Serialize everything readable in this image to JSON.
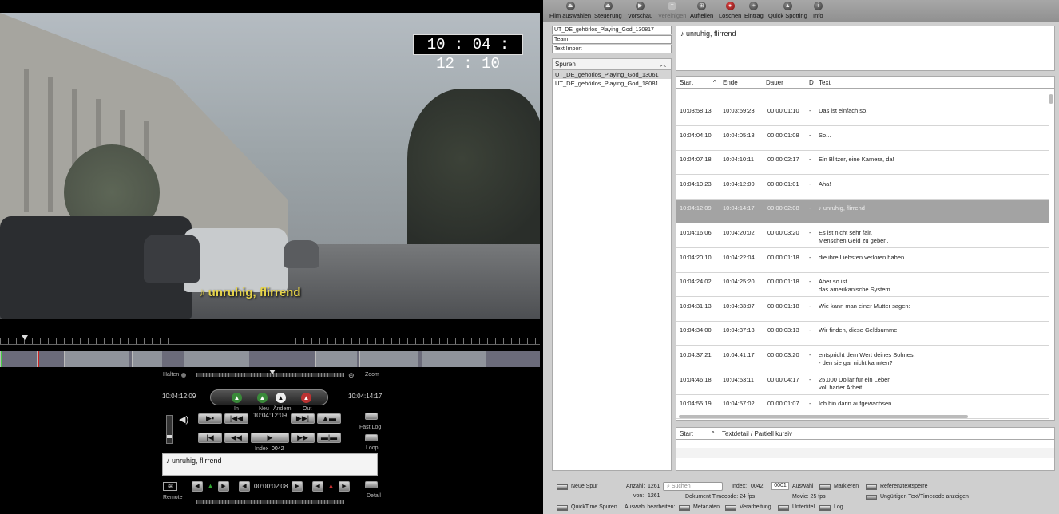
{
  "video": {
    "timecode": "10 : 04 : 12 : 10",
    "subtitle": "♪ unruhig, flirrend"
  },
  "controls": {
    "halten": "Halten",
    "zoom": "Zoom",
    "tc_left": "10:04:12:09",
    "tc_right": "10:04:14:17",
    "in": "In",
    "neu": "Neu",
    "aendern": "Ändern",
    "out": "Out",
    "tc_center": "10:04:12:09",
    "index_label": "Index",
    "index_value": "0042",
    "fast_log": "Fast Log",
    "loop": "Loop",
    "remote": "Remote",
    "detail": "Detail",
    "duration": "00:00:02:08",
    "subtitle_text": "♪ unruhig, flirrend"
  },
  "toolbar": {
    "items": [
      {
        "label": "Film auswählen",
        "icon": "film-icon"
      },
      {
        "label": "Steuerung",
        "icon": "eject-icon"
      },
      {
        "label": "Vorschau",
        "icon": "play-icon"
      },
      {
        "label": "Vereinigen",
        "icon": "merge-icon"
      },
      {
        "label": "Aufteilen",
        "icon": "split-icon"
      },
      {
        "label": "Löschen",
        "icon": "delete-icon"
      },
      {
        "label": "Eintrag",
        "icon": "plus-icon"
      },
      {
        "label": "Quick Spotting",
        "icon": "spotting-icon"
      },
      {
        "label": "Info",
        "icon": "info-icon"
      }
    ]
  },
  "files": [
    "UT_DE_gehörlos_Playing_God_130817",
    "Team",
    "Text Import"
  ],
  "tracks": {
    "header": "Spuren",
    "items": [
      "UT_DE_gehörlos_Playing_God_13061",
      "UT_DE_gehörlos_Playing_God_18081"
    ]
  },
  "preview": "♪ unruhig, flirrend",
  "table": {
    "headers": [
      "Start",
      "Ende",
      "Dauer",
      "D",
      "Text"
    ],
    "rows": [
      {
        "start": "10:03:58:13",
        "end": "10:03:59:23",
        "dur": "00:00:01:10",
        "d": "-",
        "text": "Das ist einfach so."
      },
      {
        "start": "10:04:04:10",
        "end": "10:04:05:18",
        "dur": "00:00:01:08",
        "d": "-",
        "text": "So..."
      },
      {
        "start": "10:04:07:18",
        "end": "10:04:10:11",
        "dur": "00:00:02:17",
        "d": "-",
        "text": "Ein Blitzer, eine Kamera, da!"
      },
      {
        "start": "10:04:10:23",
        "end": "10:04:12:00",
        "dur": "00:00:01:01",
        "d": "-",
        "text": "Aha!"
      },
      {
        "start": "10:04:12:09",
        "end": "10:04:14:17",
        "dur": "00:00:02:08",
        "d": "-",
        "text": "♪ unruhig, flirrend"
      },
      {
        "start": "10:04:16:06",
        "end": "10:04:20:02",
        "dur": "00:00:03:20",
        "d": "-",
        "text": "Es ist nicht sehr fair,",
        "text2": "Menschen Geld zu geben,"
      },
      {
        "start": "10:04:20:10",
        "end": "10:04:22:04",
        "dur": "00:00:01:18",
        "d": "-",
        "text": "die ihre Liebsten verloren haben."
      },
      {
        "start": "10:04:24:02",
        "end": "10:04:25:20",
        "dur": "00:00:01:18",
        "d": "-",
        "text": "Aber so ist",
        "text2": "das amerikanische System."
      },
      {
        "start": "10:04:31:13",
        "end": "10:04:33:07",
        "dur": "00:00:01:18",
        "d": "-",
        "text": "Wie kann man einer Mutter sagen:"
      },
      {
        "start": "10:04:34:00",
        "end": "10:04:37:13",
        "dur": "00:00:03:13",
        "d": "-",
        "text": "Wir finden, diese Geldsumme"
      },
      {
        "start": "10:04:37:21",
        "end": "10:04:41:17",
        "dur": "00:00:03:20",
        "d": "-",
        "text": "entspricht dem Wert deines Sohnes,",
        "text2": "- den sie gar nicht kannten?"
      },
      {
        "start": "10:04:46:18",
        "end": "10:04:53:11",
        "dur": "00:00:04:17",
        "d": "-",
        "text": "25.000 Dollar für ein Leben",
        "text2": "voll harter Arbeit."
      },
      {
        "start": "10:04:55:19",
        "end": "10:04:57:02",
        "dur": "00:00:01:07",
        "d": "-",
        "text": "Ich bin darin aufgewachsen."
      }
    ]
  },
  "detail": {
    "start": "Start",
    "text": "Textdetail / Partiell kursiv"
  },
  "bottom": {
    "neue_spur": "Neue Spur",
    "anzahl": "Anzahl:",
    "anzahl_val": "1261",
    "von": "von:",
    "von_val": "1261",
    "search_placeholder": "Suchen",
    "index": "Index:",
    "index_val": "0042",
    "auswahl_val": "0001",
    "auswahl": "Auswahl",
    "markieren": "Markieren",
    "referenz": "Referenztextsperre",
    "ungueltig": "Ungültigen Text/Timecode anzeigen",
    "doc_tc": "Dokument Timecode: 24 fps",
    "movie": "Movie: 25 fps",
    "quicktime": "QuickTime Spuren",
    "auswahl_bearb": "Auswahl bearbeiten:",
    "metadaten": "Metadaten",
    "verarbeitung": "Verarbeitung",
    "untertitel": "Untertitel",
    "log": "Log"
  }
}
